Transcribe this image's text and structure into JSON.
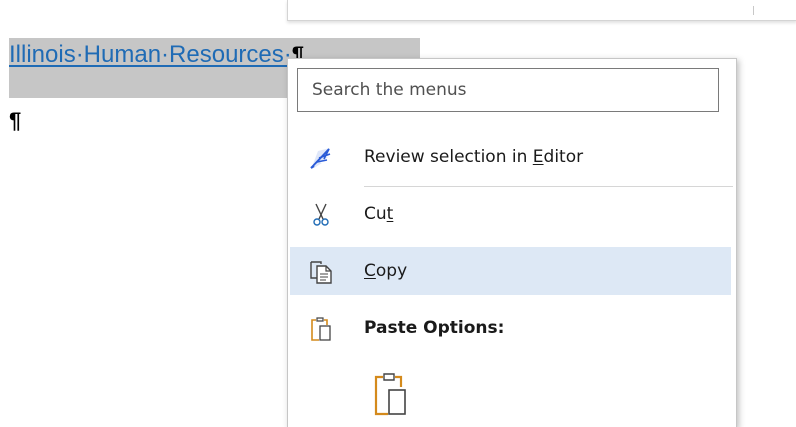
{
  "document": {
    "heading_text": "Illinois·Human·Resources·",
    "pilcrow": "¶",
    "empty_paragraph_mark": "¶"
  },
  "context_menu": {
    "search": {
      "placeholder": "Search the menus",
      "value": ""
    },
    "items": [
      {
        "id": "review",
        "label_pre": "Review selection in ",
        "mnemonic": "E",
        "label_post": "ditor",
        "icon": "editor-pen-icon"
      },
      {
        "id": "cut",
        "label_pre": "Cu",
        "mnemonic": "t",
        "label_post": "",
        "icon": "scissors-icon"
      },
      {
        "id": "copy",
        "label_pre": "",
        "mnemonic": "C",
        "label_post": "opy",
        "icon": "copy-icon",
        "highlighted": true
      },
      {
        "id": "paste-options",
        "label": "Paste Options:",
        "icon": "clipboard-icon"
      }
    ],
    "paste_option_icon": "clipboard-keep-formatting-icon"
  },
  "colors": {
    "link_blue": "#1f6bb5",
    "selection_gray": "#c6c6c6",
    "menu_highlight": "#dde8f5",
    "editor_icon_blue": "#2a5bd7",
    "clipboard_orange": "#d48a1c"
  }
}
